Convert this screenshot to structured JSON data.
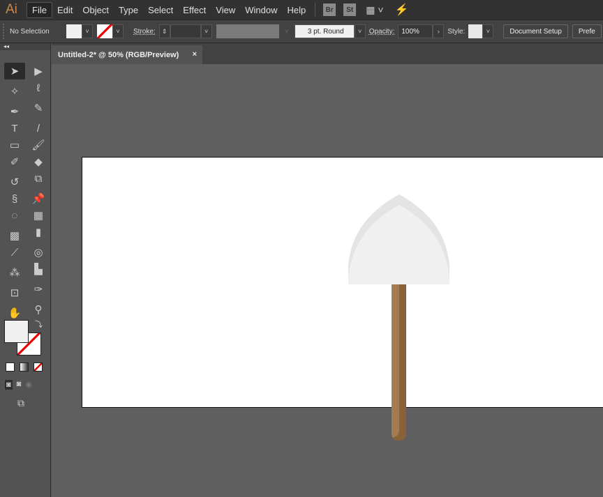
{
  "app": {
    "logo": "Ai"
  },
  "menu": [
    "File",
    "Edit",
    "Object",
    "Type",
    "Select",
    "Effect",
    "View",
    "Window",
    "Help"
  ],
  "menu_icons": {
    "bridge": "Br",
    "stock": "St"
  },
  "control": {
    "selection": "No Selection",
    "stroke_label": "Stroke:",
    "brush": "3 pt. Round",
    "opacity_label": "Opacity:",
    "opacity": "100%",
    "style_label": "Style:",
    "doc_setup": "Document Setup",
    "prefs": "Prefe"
  },
  "tab": {
    "title": "Untitled-2* @ 50% (RGB/Preview)",
    "close": "×"
  },
  "tools": [
    {
      "name": "selection",
      "g": "➤"
    },
    {
      "name": "direct-selection",
      "g": "▶"
    },
    {
      "name": "magic-wand",
      "g": "✧"
    },
    {
      "name": "lasso",
      "g": "ℓ"
    },
    {
      "name": "pen",
      "g": "✒"
    },
    {
      "name": "curvature",
      "g": "✎"
    },
    {
      "name": "type",
      "g": "T"
    },
    {
      "name": "line",
      "g": "/"
    },
    {
      "name": "rectangle",
      "g": "▭"
    },
    {
      "name": "paintbrush",
      "g": "🖌"
    },
    {
      "name": "shaper",
      "g": "✐"
    },
    {
      "name": "eraser",
      "g": "◆"
    },
    {
      "name": "rotate",
      "g": "↺"
    },
    {
      "name": "scale",
      "g": "⧉"
    },
    {
      "name": "warp",
      "g": "§"
    },
    {
      "name": "puppet-warp",
      "g": "📌"
    },
    {
      "name": "shape-builder",
      "g": "◌"
    },
    {
      "name": "perspective-grid",
      "g": "▦"
    },
    {
      "name": "mesh",
      "g": "▩"
    },
    {
      "name": "gradient",
      "g": "▮"
    },
    {
      "name": "eyedropper",
      "g": "⟋"
    },
    {
      "name": "blend",
      "g": "◎"
    },
    {
      "name": "symbol-sprayer",
      "g": "⁂"
    },
    {
      "name": "column-graph",
      "g": "▙"
    },
    {
      "name": "artboard",
      "g": "⊡"
    },
    {
      "name": "slice",
      "g": "✑"
    },
    {
      "name": "hand",
      "g": "✋"
    },
    {
      "name": "zoom",
      "g": "⚲"
    }
  ],
  "colors": {
    "fill": "#f0f0f0",
    "blade_edge": "#e4e4e4",
    "handle_light": "#a57c52",
    "handle_dark": "#8a6239"
  }
}
